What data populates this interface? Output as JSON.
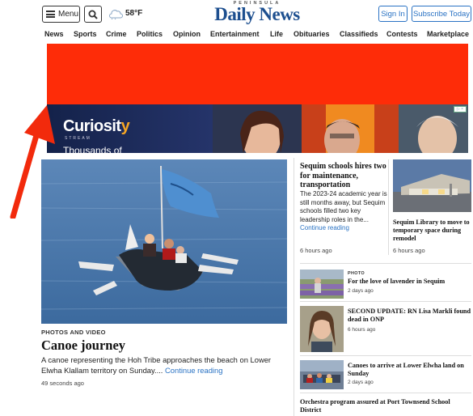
{
  "header": {
    "menu_label": "Menu",
    "weather_temp": "58°F",
    "logo_small": "PENINSULA",
    "logo_big": "Daily News",
    "signin_label": "Sign In",
    "subscribe_label": "Subscribe Today"
  },
  "nav": [
    "News",
    "Sports",
    "Crime",
    "Politics",
    "Opinion",
    "Entertainment",
    "Life",
    "Obituaries",
    "Classifieds",
    "Contests",
    "Marketplace"
  ],
  "banner_ad": {
    "brand_prefix": "Curiosit",
    "brand_suffix": "y",
    "stream": "STREAM",
    "tagline": "Thousands of"
  },
  "colors": {
    "accent": "#2a73c4",
    "logo": "#1d4f8f",
    "ad_red": "#fe2c08",
    "arrow": "#f22a0c"
  },
  "main_story": {
    "kicker": "PHOTOS AND VIDEO",
    "headline": "Canoe journey",
    "summary": "A canoe representing the Hoh Tribe approaches the beach on Lower Elwha Klallam territory on Sunday....",
    "continue": "Continue reading",
    "time": "49 seconds ago"
  },
  "story1": {
    "title": "Sequim schools hires two for maintenance, transportation",
    "summary": "The 2023-24 academic year is still months away, but Sequim schools filled two key leadership roles in the...",
    "continue": "Continue reading",
    "time": "6 hours ago"
  },
  "story2": {
    "title": "Sequim Library to move to temporary space during remodel",
    "time": "6 hours ago"
  },
  "list": [
    {
      "kicker": "PHOTO",
      "title": "For the love of lavender in Sequim",
      "time": "2 days ago"
    },
    {
      "kicker": "",
      "title": "SECOND UPDATE: RN Lisa Markli found dead in ONP",
      "time": "6 hours ago"
    },
    {
      "kicker": "",
      "title": "Canoes to arrive at Lower Elwha land on Sunday",
      "time": "2 days ago"
    }
  ],
  "last_story": {
    "title": "Orchestra program assured at Port Townsend School District"
  }
}
